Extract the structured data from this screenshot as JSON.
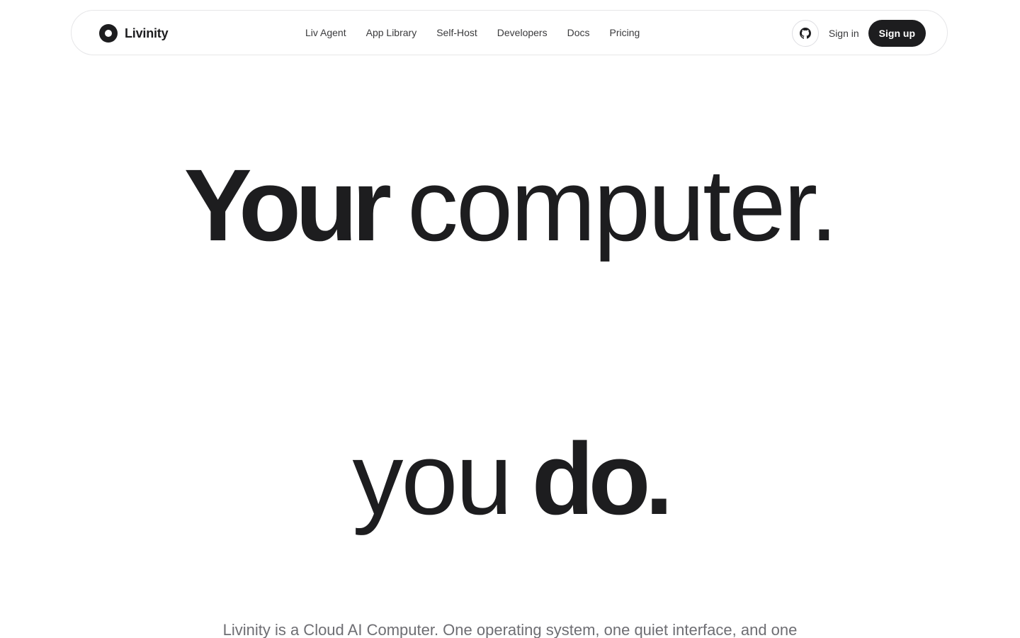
{
  "brand": {
    "name": "Livinity",
    "logo_icon": "circle-logo-icon"
  },
  "nav": {
    "links": [
      {
        "label": "Liv Agent"
      },
      {
        "label": "App Library"
      },
      {
        "label": "Self-Host"
      },
      {
        "label": "Developers"
      },
      {
        "label": "Docs"
      },
      {
        "label": "Pricing"
      }
    ],
    "github_icon": "github-icon",
    "sign_in": "Sign in",
    "sign_up": "Sign up"
  },
  "hero": {
    "line1_bold": "Your",
    "line1_light": "computer.",
    "line2_light": "you",
    "line2_bold": "do."
  },
  "subtitle": "Livinity is a Cloud AI Computer. One operating system, one quiet interface, and one",
  "colors": {
    "text": "#1d1d1f",
    "muted": "#6e6e73",
    "border": "#e6e6e8",
    "button_bg": "#1d1d1f",
    "button_text": "#ffffff"
  }
}
